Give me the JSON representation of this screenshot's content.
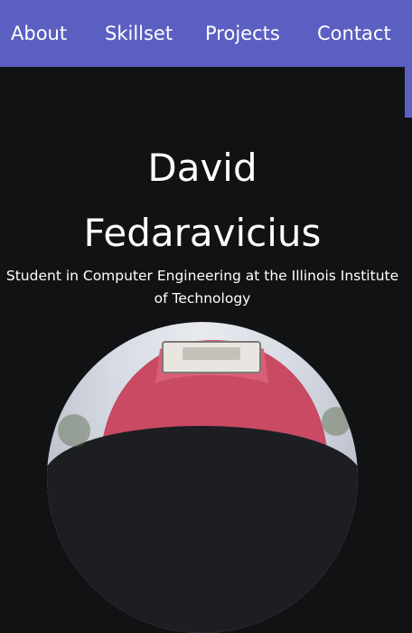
{
  "nav": {
    "items": [
      {
        "label": "About"
      },
      {
        "label": "Skillset"
      },
      {
        "label": "Projects"
      },
      {
        "label": "Contact"
      }
    ]
  },
  "hero": {
    "name_line1": "David",
    "name_line2": "Fedaravicius",
    "subtitle_line1": "Student in Computer Engineering at the Illinois Institute",
    "subtitle_line2": "of Technology"
  },
  "colors": {
    "nav_background": "#5b5fc1",
    "page_background": "#111214",
    "text": "#ffffff"
  }
}
